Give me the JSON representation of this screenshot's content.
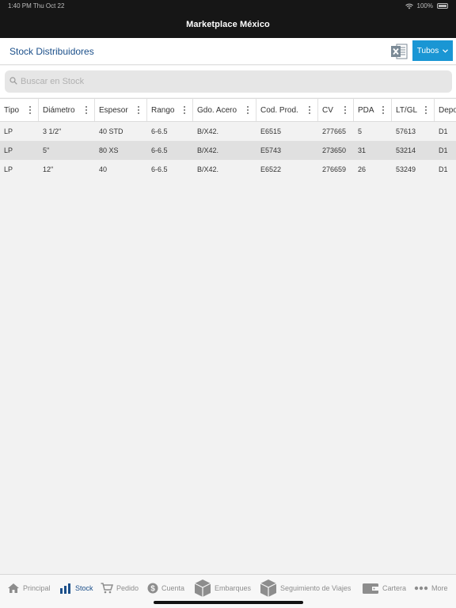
{
  "status_bar": {
    "time": "1:40 PM  Thu Oct 22",
    "battery": "100%"
  },
  "nav": {
    "title": "Marketplace México"
  },
  "section": {
    "title": "Stock Distribuidores",
    "product_selector": "Tubos"
  },
  "search": {
    "placeholder": "Buscar en Stock"
  },
  "table": {
    "columns": [
      "Tipo",
      "Diámetro",
      "Espesor",
      "Rango",
      "Gdo. Acero",
      "Cod. Prod.",
      "CV",
      "PDA",
      "LT/GL",
      "Depo"
    ],
    "rows": [
      [
        "LP",
        "3 1/2\"",
        "40 STD",
        "6-6.5",
        "B/X42.",
        "E6515",
        "277665",
        "5",
        "57613",
        "D1"
      ],
      [
        "LP",
        "5\"",
        "80 XS",
        "6-6.5",
        "B/X42.",
        "E5743",
        "273650",
        "31",
        "53214",
        "D1"
      ],
      [
        "LP",
        "12\"",
        "40",
        "6-6.5",
        "B/X42.",
        "E6522",
        "276659",
        "26",
        "53249",
        "D1"
      ]
    ]
  },
  "tabs": [
    {
      "label": "Principal",
      "icon": "home-icon"
    },
    {
      "label": "Stock",
      "icon": "bar-chart-icon"
    },
    {
      "label": "Pedido",
      "icon": "cart-icon"
    },
    {
      "label": "Cuenta",
      "icon": "dollar-icon"
    },
    {
      "label": "Embarques",
      "icon": "box-icon"
    },
    {
      "label": "Seguimiento de Viajes",
      "icon": "box-icon"
    },
    {
      "label": "Cartera",
      "icon": "wallet-icon"
    },
    {
      "label": "More",
      "icon": "more-icon"
    }
  ],
  "colors": {
    "accent": "#1a96d4",
    "active_tab": "#1b4f8a",
    "navbar": "#161616",
    "excel": "#7b8a96"
  }
}
